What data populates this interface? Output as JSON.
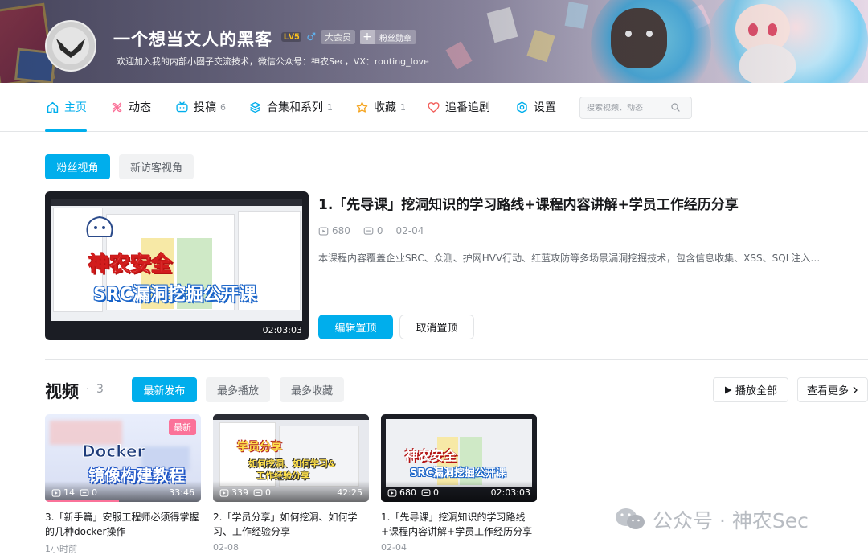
{
  "profile": {
    "username": "一个想当文人的黑客",
    "level": "LV5",
    "gender_symbol": "♂",
    "vip_label": "大会员",
    "fan_medal_label": "粉丝勋章",
    "signature": "欢迎加入我的内部小圈子交流技术，微信公众号：神农Sec，VX：routing_love"
  },
  "nav": {
    "items": [
      {
        "label": "主页",
        "count": "",
        "icon": "home-icon"
      },
      {
        "label": "动态",
        "count": "",
        "icon": "pinwheel-icon"
      },
      {
        "label": "投稿",
        "count": "6",
        "icon": "tv-icon"
      },
      {
        "label": "合集和系列",
        "count": "1",
        "icon": "layers-icon"
      },
      {
        "label": "收藏",
        "count": "1",
        "icon": "star-icon"
      },
      {
        "label": "追番追剧",
        "count": "",
        "icon": "heart-icon"
      },
      {
        "label": "设置",
        "count": "",
        "icon": "settings-icon"
      }
    ],
    "search_placeholder": "搜索视频、动态"
  },
  "view_toggle": {
    "fan_view": "粉丝视角",
    "guest_view": "新访客视角"
  },
  "pinned": {
    "title": "1.「先导课」挖洞知识的学习路线+课程内容讲解+学员工作经历分享",
    "views": "680",
    "comments": "0",
    "date": "02-04",
    "description": "本课程内容覆盖企业SRC、众测、护网HVV行动、红蓝攻防等多场景漏洞挖掘技术，包含信息收集、XSS、SQL注入…",
    "duration": "02:03:03",
    "thumb_text_1": "神农安全",
    "thumb_text_2": "SRC漏洞挖掘公开课",
    "edit_button": "编辑置顶",
    "cancel_button": "取消置顶"
  },
  "videos_section": {
    "title": "视频",
    "separator": "·",
    "count": "3",
    "sort_options": [
      "最新发布",
      "最多播放",
      "最多收藏"
    ],
    "play_all": "播放全部",
    "see_more": "查看更多",
    "items": [
      {
        "title": "3.「新手篇」安服工程师必须得掌握的几种docker操作",
        "views": "14",
        "comments": "0",
        "duration": "33:46",
        "date": "1小时前",
        "badge": "最新",
        "thumb_text_1": "Docker",
        "thumb_text_2": "镜像构建教程"
      },
      {
        "title": "2.「学员分享」如何挖洞、如何学习、工作经验分享",
        "views": "339",
        "comments": "0",
        "duration": "42:25",
        "date": "02-08",
        "badge": "",
        "thumb_text_1": "学员分享",
        "thumb_text_2": "如何挖洞、如何学习&",
        "thumb_text_3": "工作经验分享"
      },
      {
        "title": "1.「先导课」挖洞知识的学习路线+课程内容讲解+学员工作经历分享",
        "views": "680",
        "comments": "0",
        "duration": "02:03:03",
        "date": "02-04",
        "badge": "",
        "thumb_text_1": "神农安全",
        "thumb_text_2": "SRC漏洞挖掘公开课"
      }
    ]
  },
  "watermark": {
    "text": "公众号 · 神农Sec"
  },
  "colors": {
    "accent": "#00aeec",
    "badge_pink": "#fb7299",
    "muted": "#9499a0"
  }
}
